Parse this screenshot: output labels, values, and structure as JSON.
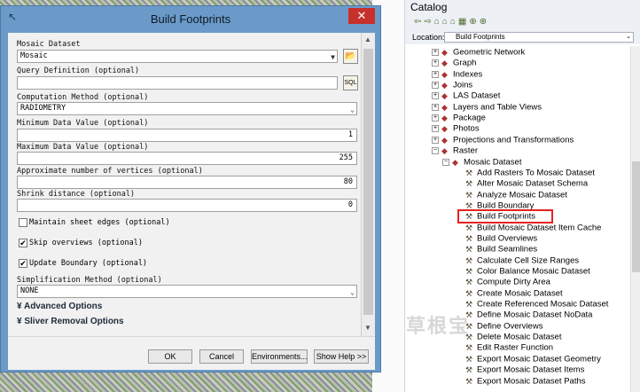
{
  "dialog": {
    "title": "Build Footprints",
    "close": "✕",
    "fields": {
      "mosaic_label": "Mosaic Dataset",
      "mosaic_value": "Mosaic",
      "query_label": "Query Definition (optional)",
      "query_value": "",
      "computation_label": "Computation Method (optional)",
      "computation_value": "RADIOMETRY",
      "min_label": "Minimum Data Value (optional)",
      "min_value": "1",
      "max_label": "Maximum Data Value (optional)",
      "max_value": "255",
      "vertices_label": "Approximate number of vertices (optional)",
      "vertices_value": "80",
      "shrink_label": "Shrink distance (optional)",
      "shrink_value": "0",
      "maintain_label": "Maintain sheet edges (optional)",
      "skip_label": "Skip overviews (optional)",
      "update_label": "Update Boundary (optional)",
      "simplification_label": "Simplification Method (optional)",
      "simplification_value": "NONE"
    },
    "checkboxes": {
      "maintain": false,
      "skip": true,
      "update": true
    },
    "sections": {
      "advanced": "Advanced Options",
      "sliver": "Sliver Removal Options"
    },
    "buttons": {
      "ok": "OK",
      "cancel": "Cancel",
      "environments": "Environments...",
      "help": "Show Help >>"
    }
  },
  "catalog": {
    "title": "Catalog",
    "location_label": "Location:",
    "location_value": "Build Footprints",
    "items": [
      {
        "label": "Geometric Network",
        "level": 1,
        "type": "toolset"
      },
      {
        "label": "Graph",
        "level": 1,
        "type": "toolset"
      },
      {
        "label": "Indexes",
        "level": 1,
        "type": "toolset"
      },
      {
        "label": "Joins",
        "level": 1,
        "type": "toolset"
      },
      {
        "label": "LAS Dataset",
        "level": 1,
        "type": "toolset"
      },
      {
        "label": "Layers and Table Views",
        "level": 1,
        "type": "toolset"
      },
      {
        "label": "Package",
        "level": 1,
        "type": "toolset"
      },
      {
        "label": "Photos",
        "level": 1,
        "type": "toolset"
      },
      {
        "label": "Projections and Transformations",
        "level": 1,
        "type": "toolset"
      },
      {
        "label": "Raster",
        "level": 1,
        "type": "toolset-open"
      },
      {
        "label": "Mosaic Dataset",
        "level": 2,
        "type": "toolset-open"
      },
      {
        "label": "Add Rasters To Mosaic Dataset",
        "level": 3,
        "type": "tool"
      },
      {
        "label": "Alter Mosaic Dataset Schema",
        "level": 3,
        "type": "tool"
      },
      {
        "label": "Analyze Mosaic Dataset",
        "level": 3,
        "type": "tool"
      },
      {
        "label": "Build Boundary",
        "level": 3,
        "type": "tool"
      },
      {
        "label": "Build Footprints",
        "level": 3,
        "type": "tool"
      },
      {
        "label": "Build Mosaic Dataset Item Cache",
        "level": 3,
        "type": "tool"
      },
      {
        "label": "Build Overviews",
        "level": 3,
        "type": "tool"
      },
      {
        "label": "Build Seamlines",
        "level": 3,
        "type": "tool"
      },
      {
        "label": "Calculate Cell Size Ranges",
        "level": 3,
        "type": "tool"
      },
      {
        "label": "Color Balance Mosaic Dataset",
        "level": 3,
        "type": "tool"
      },
      {
        "label": "Compute Dirty Area",
        "level": 3,
        "type": "tool"
      },
      {
        "label": "Create Mosaic Dataset",
        "level": 3,
        "type": "tool"
      },
      {
        "label": "Create Referenced Mosaic Dataset",
        "level": 3,
        "type": "tool"
      },
      {
        "label": "Define Mosaic Dataset NoData",
        "level": 3,
        "type": "tool"
      },
      {
        "label": "Define Overviews",
        "level": 3,
        "type": "tool"
      },
      {
        "label": "Delete Mosaic Dataset",
        "level": 3,
        "type": "tool"
      },
      {
        "label": "Edit Raster Function",
        "level": 3,
        "type": "tool"
      },
      {
        "label": "Export Mosaic Dataset Geometry",
        "level": 3,
        "type": "tool"
      },
      {
        "label": "Export Mosaic Dataset Items",
        "level": 3,
        "type": "tool"
      },
      {
        "label": "Export Mosaic Dataset Paths",
        "level": 3,
        "type": "tool"
      }
    ],
    "highlighted": "Build Footprints"
  },
  "watermark": "草根宝"
}
